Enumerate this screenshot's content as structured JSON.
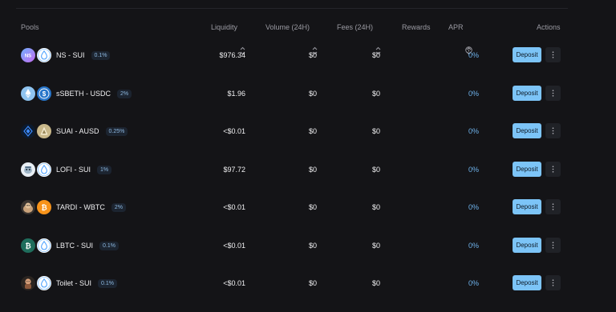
{
  "header": {
    "pools": "Pools",
    "liquidity": "Liquidity",
    "volume": "Volume (24H)",
    "fees": "Fees (24H)",
    "rewards": "Rewards",
    "apr": "APR",
    "actions": "Actions"
  },
  "deposit_label": "Deposit",
  "rows": [
    {
      "name": "NS - SUI",
      "fee": "0.1%",
      "liquidity": "$976.34",
      "volume": "$0",
      "fees": "$0",
      "apr": "0%",
      "icon1": "ns-token",
      "icon2": "sui-token"
    },
    {
      "name": "sSBETH - USDC",
      "fee": "2%",
      "liquidity": "$1.96",
      "volume": "$0",
      "fees": "$0",
      "apr": "0%",
      "icon1": "eth-token",
      "icon2": "usdc-token"
    },
    {
      "name": "SUAI - AUSD",
      "fee": "0.25%",
      "liquidity": "<$0.01",
      "volume": "$0",
      "fees": "$0",
      "apr": "0%",
      "icon1": "suai-token",
      "icon2": "ausd-token"
    },
    {
      "name": "LOFI - SUI",
      "fee": "1%",
      "liquidity": "$97.72",
      "volume": "$0",
      "fees": "$0",
      "apr": "0%",
      "icon1": "lofi-token",
      "icon2": "sui-token"
    },
    {
      "name": "TARDI - WBTC",
      "fee": "2%",
      "liquidity": "<$0.01",
      "volume": "$0",
      "fees": "$0",
      "apr": "0%",
      "icon1": "tardi-token",
      "icon2": "btc-token"
    },
    {
      "name": "LBTC - SUI",
      "fee": "0.1%",
      "liquidity": "<$0.01",
      "volume": "$0",
      "fees": "$0",
      "apr": "0%",
      "icon1": "lbtc-token",
      "icon2": "sui-token"
    },
    {
      "name": "Toilet - SUI",
      "fee": "0.1%",
      "liquidity": "<$0.01",
      "volume": "$0",
      "fees": "$0",
      "apr": "0%",
      "icon1": "toilet-token",
      "icon2": "sui-token"
    }
  ],
  "colors": {
    "accent": "#7cc4f7",
    "apr": "#6fb4ee",
    "background": "#141417"
  }
}
